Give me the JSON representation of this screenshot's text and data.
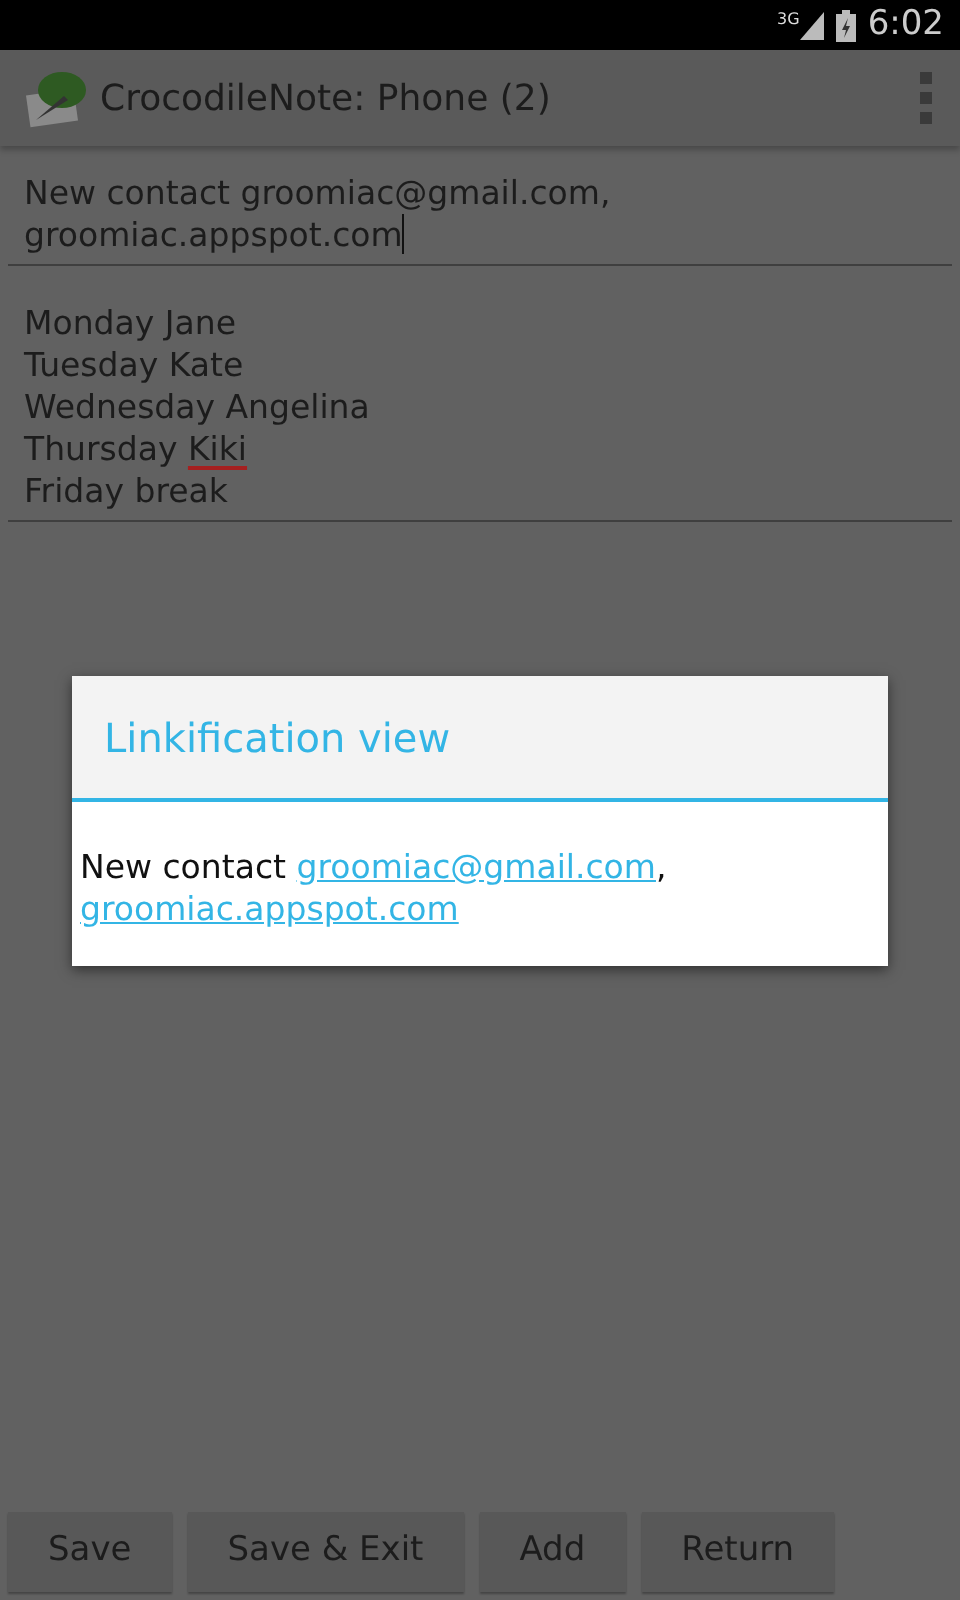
{
  "status_bar": {
    "time": "6:02",
    "network": "3G"
  },
  "action_bar": {
    "title": "CrocodileNote: Phone (2)"
  },
  "title_field": {
    "value": "New contact groomiac@gmail.com, groomiac.appspot.com",
    "focused": true
  },
  "body_field": {
    "lines": [
      {
        "parts": [
          {
            "text": "Monday Jane",
            "misspelled": false
          }
        ]
      },
      {
        "parts": [
          {
            "text": "Tuesday Kate",
            "misspelled": false
          }
        ]
      },
      {
        "parts": [
          {
            "text": "Wednesday Angelina",
            "misspelled": false
          }
        ]
      },
      {
        "parts": [
          {
            "text": "Thursday ",
            "misspelled": false
          },
          {
            "text": "Kiki",
            "misspelled": true
          }
        ]
      },
      {
        "parts": [
          {
            "text": "Friday break",
            "misspelled": false
          }
        ]
      }
    ]
  },
  "dialog": {
    "title": "Linkification view",
    "message": [
      {
        "kind": "text",
        "text": "New contact "
      },
      {
        "kind": "link",
        "text": "groomiac@gmail.com"
      },
      {
        "kind": "text",
        "text": ", "
      },
      {
        "kind": "link",
        "text": "groomiac.appspot.com"
      }
    ]
  },
  "buttons": [
    "Save",
    "Save & Exit",
    "Add",
    "Return"
  ]
}
